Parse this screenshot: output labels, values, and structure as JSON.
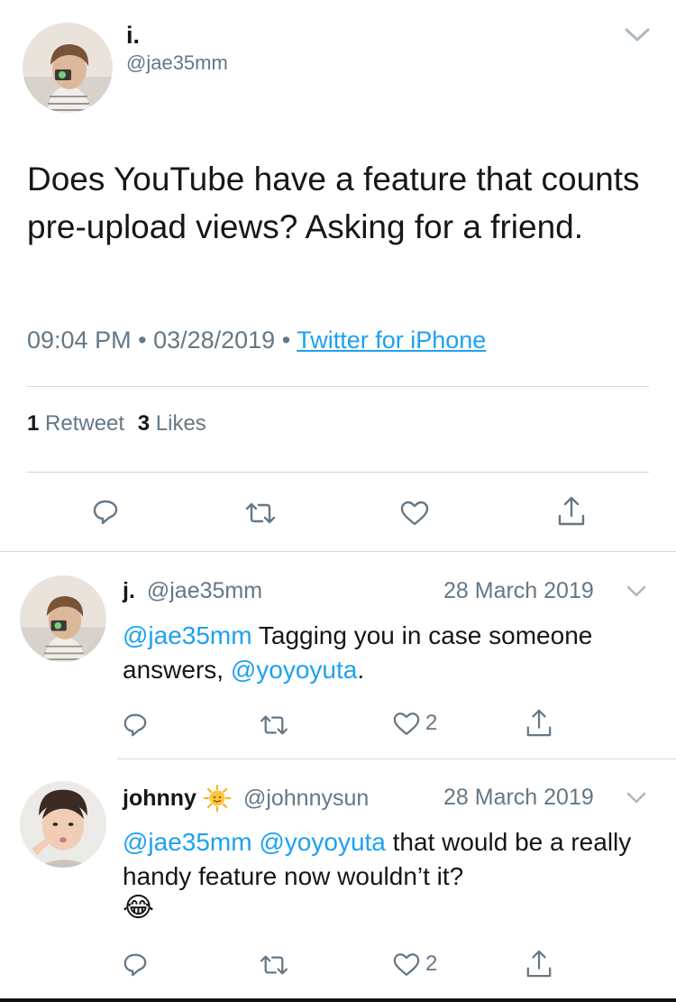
{
  "main_tweet": {
    "display_name": "i.",
    "handle": "@jae35mm",
    "text": "Does YouTube have a feature that counts pre-upload views? Asking for a friend.",
    "time": "09:04 PM",
    "date": "03/28/2019",
    "separator": "•",
    "source": "Twitter for iPhone",
    "retweet_count": "1",
    "retweet_label": "Retweet",
    "like_count": "3",
    "like_label": "Likes"
  },
  "replies": [
    {
      "display_name": "j.",
      "handle": "@jae35mm",
      "date": "28 March 2019",
      "mention": "@jae35mm",
      "text_1": " Tagging you in case someone answers, ",
      "mention_2": "@yoyoyuta",
      "text_2": ".",
      "like_count": "2"
    },
    {
      "display_name": "johnny",
      "handle": "@johnnysun",
      "date": "28 March 2019",
      "mention": "@jae35mm",
      "mention_2": "@yoyoyuta",
      "text_1": " that would be a really handy feature now wouldn’t it?",
      "emoji": "😂",
      "like_count": "2"
    }
  ],
  "icons": {
    "chevron": "chevron-down-icon",
    "reply": "reply-icon",
    "retweet": "retweet-icon",
    "like": "heart-icon",
    "share": "share-icon",
    "sun_emoji": "sun-with-face-icon"
  },
  "colors": {
    "link": "#1da1f2",
    "muted": "#657786",
    "divider": "#d3d6da"
  }
}
